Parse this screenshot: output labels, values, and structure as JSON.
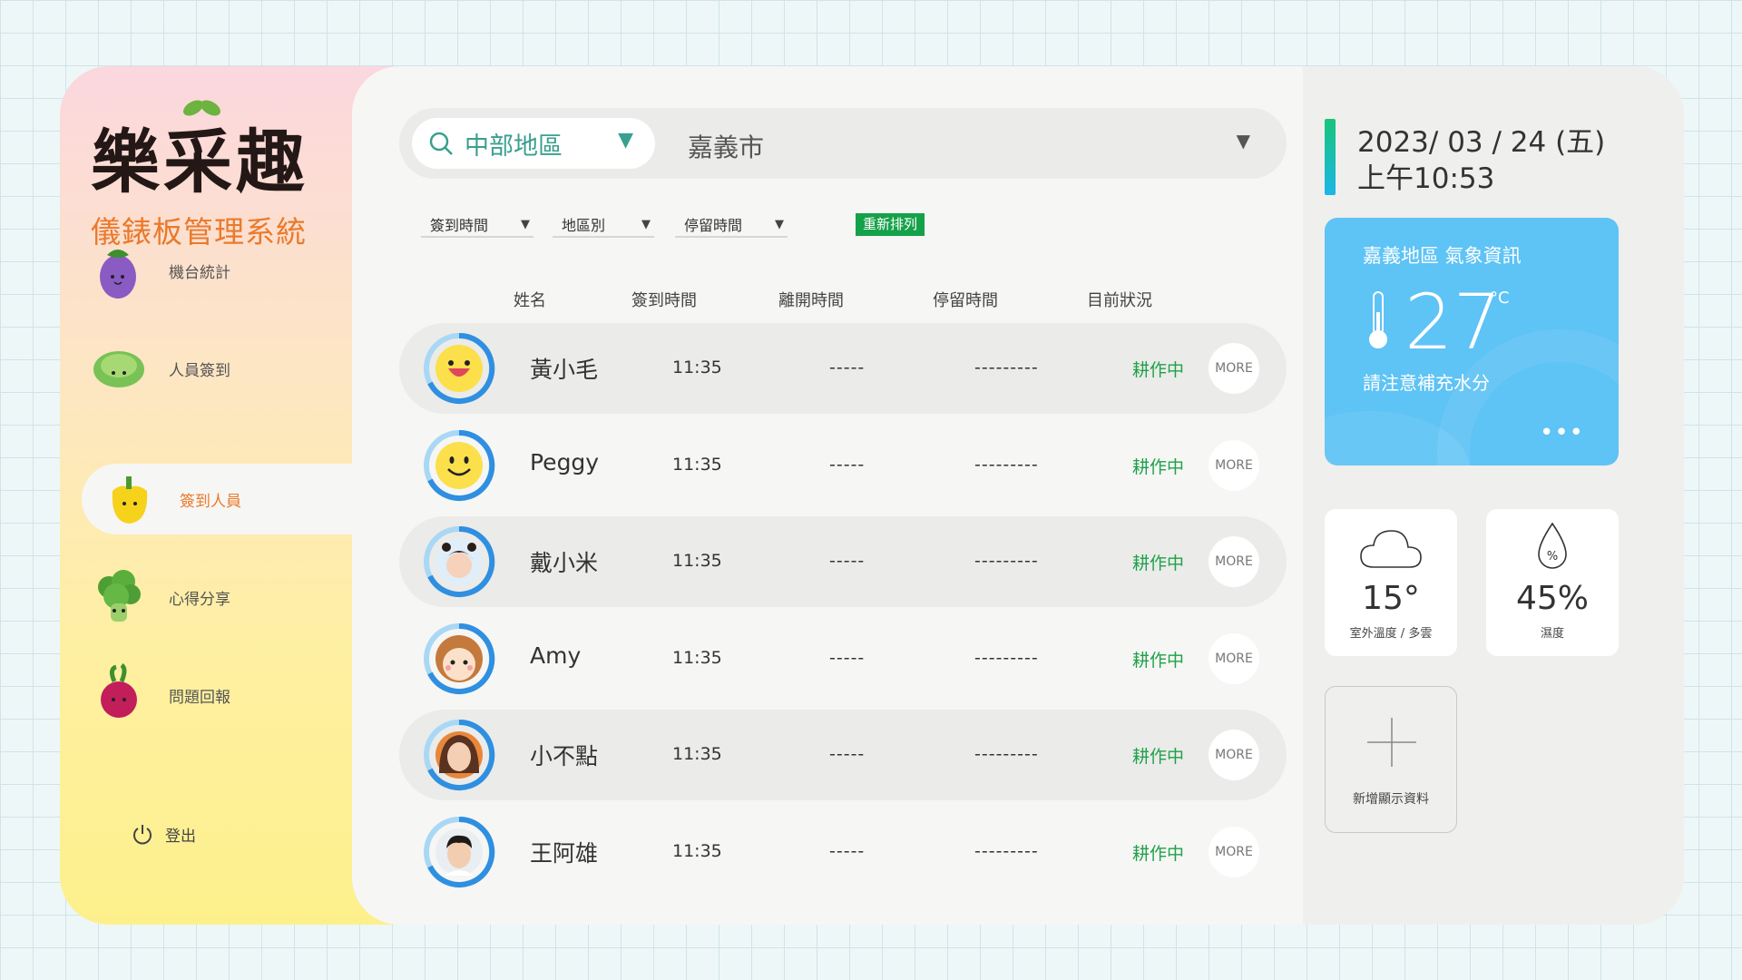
{
  "brand": {
    "title": "樂采趣",
    "subtitle": "儀錶板管理系統"
  },
  "sidebar": {
    "items": [
      {
        "label": "機台統計",
        "icon": "eggplant-icon"
      },
      {
        "label": "人員簽到",
        "icon": "lettuce-icon"
      },
      {
        "label": "簽到人員",
        "icon": "bell-pepper-icon",
        "active": true
      },
      {
        "label": "心得分享",
        "icon": "broccoli-icon"
      },
      {
        "label": "問題回報",
        "icon": "beet-icon"
      }
    ],
    "logout": "登出"
  },
  "search": {
    "region": "中部地區",
    "city": "嘉義市"
  },
  "filters": {
    "checkin": "簽到時間",
    "area": "地區別",
    "stay": "停留時間",
    "resort": "重新排列"
  },
  "table": {
    "headers": {
      "name": "姓名",
      "checkin": "簽到時間",
      "leave": "離開時間",
      "stay": "停留時間",
      "status": "目前狀況"
    },
    "more_label": "MORE",
    "rows": [
      {
        "name": "黃小毛",
        "checkin": "11:35",
        "leave": "-----",
        "stay": "---------",
        "status": "耕作中"
      },
      {
        "name": "Peggy",
        "checkin": "11:35",
        "leave": "-----",
        "stay": "---------",
        "status": "耕作中"
      },
      {
        "name": "戴小米",
        "checkin": "11:35",
        "leave": "-----",
        "stay": "---------",
        "status": "耕作中"
      },
      {
        "name": "Amy",
        "checkin": "11:35",
        "leave": "-----",
        "stay": "---------",
        "status": "耕作中"
      },
      {
        "name": "小不點",
        "checkin": "11:35",
        "leave": "-----",
        "stay": "---------",
        "status": "耕作中"
      },
      {
        "name": "王阿雄",
        "checkin": "11:35",
        "leave": "-----",
        "stay": "---------",
        "status": "耕作中"
      }
    ]
  },
  "datetime": {
    "date": "2023/ 03 / 24 (五)",
    "time": "上午10:53"
  },
  "weather": {
    "title": "嘉義地區 氣象資訊",
    "temp": "27",
    "unit": "°C",
    "tip": "請注意補充水分",
    "more": "•••"
  },
  "outdoor": {
    "value": "15°",
    "caption": "室外溫度 / 多雲"
  },
  "humidity": {
    "value": "45%",
    "caption": "濕度",
    "icon_text": "%"
  },
  "add_card": {
    "caption": "新增顯示資料"
  },
  "colors": {
    "accent": "#3a9f8e",
    "status": "#1fa14a",
    "weather": "#5ec3f5",
    "orange": "#ea7a2c"
  }
}
